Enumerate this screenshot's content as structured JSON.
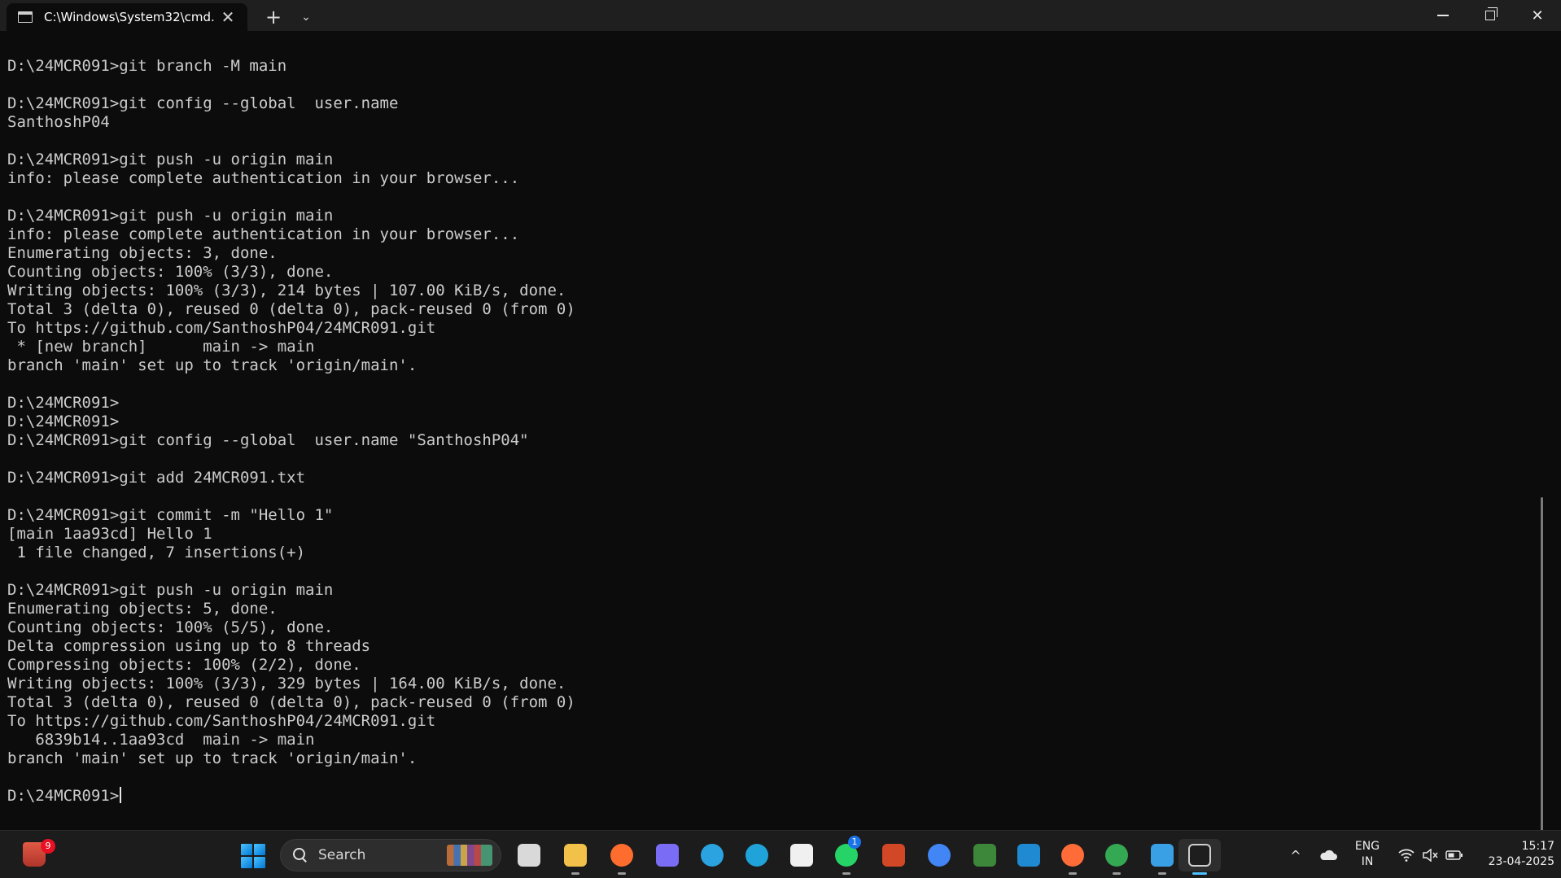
{
  "window": {
    "tab_title": "C:\\Windows\\System32\\cmd.e",
    "tab_close": "✕",
    "new_tab": "+",
    "dropdown": "⌄",
    "close": "✕"
  },
  "terminal": {
    "lines": [
      "D:\\24MCR091>git branch -M main",
      "",
      "D:\\24MCR091>git config --global  user.name",
      "SanthoshP04",
      "",
      "D:\\24MCR091>git push -u origin main",
      "info: please complete authentication in your browser...",
      "",
      "D:\\24MCR091>git push -u origin main",
      "info: please complete authentication in your browser...",
      "Enumerating objects: 3, done.",
      "Counting objects: 100% (3/3), done.",
      "Writing objects: 100% (3/3), 214 bytes | 107.00 KiB/s, done.",
      "Total 3 (delta 0), reused 0 (delta 0), pack-reused 0 (from 0)",
      "To https://github.com/SanthoshP04/24MCR091.git",
      " * [new branch]      main -> main",
      "branch 'main' set up to track 'origin/main'.",
      "",
      "D:\\24MCR091>",
      "D:\\24MCR091>",
      "D:\\24MCR091>git config --global  user.name \"SanthoshP04\"",
      "",
      "D:\\24MCR091>git add 24MCR091.txt",
      "",
      "D:\\24MCR091>git commit -m \"Hello 1\"",
      "[main 1aa93cd] Hello 1",
      " 1 file changed, 7 insertions(+)",
      "",
      "D:\\24MCR091>git push -u origin main",
      "Enumerating objects: 5, done.",
      "Counting objects: 100% (5/5), done.",
      "Delta compression using up to 8 threads",
      "Compressing objects: 100% (2/2), done.",
      "Writing objects: 100% (3/3), 329 bytes | 164.00 KiB/s, done.",
      "Total 3 (delta 0), reused 0 (delta 0), pack-reused 0 (from 0)",
      "To https://github.com/SanthoshP04/24MCR091.git",
      "   6839b14..1aa93cd  main -> main",
      "branch 'main' set up to track 'origin/main'.",
      ""
    ],
    "prompt": "D:\\24MCR091>"
  },
  "taskbar": {
    "notification_count": "9",
    "search_placeholder": "Search",
    "whatsapp_badge": "1",
    "tray_chevron": "^",
    "lang_line1": "ENG",
    "lang_line2": "IN",
    "time": "15:17",
    "date": "23-04-2025",
    "apps": [
      {
        "name": "task-view-icon",
        "color": "#d9d9d9"
      },
      {
        "name": "file-explorer-icon",
        "color": "#f2c14a"
      },
      {
        "name": "firefox-icon",
        "color": "#ff6d2e"
      },
      {
        "name": "copilot-icon",
        "color": "#7b6cf6"
      },
      {
        "name": "telegram-icon",
        "color": "#2aa3e0"
      },
      {
        "name": "edge-icon",
        "color": "#1fa3d9"
      },
      {
        "name": "microsoft-store-icon",
        "color": "#f0f0f0"
      },
      {
        "name": "whatsapp-icon",
        "color": "#25d366"
      },
      {
        "name": "powerpoint-icon",
        "color": "#d24726"
      },
      {
        "name": "chrome-icon",
        "color": "#4285f4"
      },
      {
        "name": "nodejs-icon",
        "color": "#3c873a"
      },
      {
        "name": "vscode-icon",
        "color": "#1f8ad2"
      },
      {
        "name": "postman-icon",
        "color": "#ff6c37"
      },
      {
        "name": "chrome-profile-icon",
        "color": "#34a853"
      },
      {
        "name": "notepad-icon",
        "color": "#3aa0e6"
      },
      {
        "name": "terminal-icon",
        "color": "#3a3a3a"
      }
    ]
  }
}
